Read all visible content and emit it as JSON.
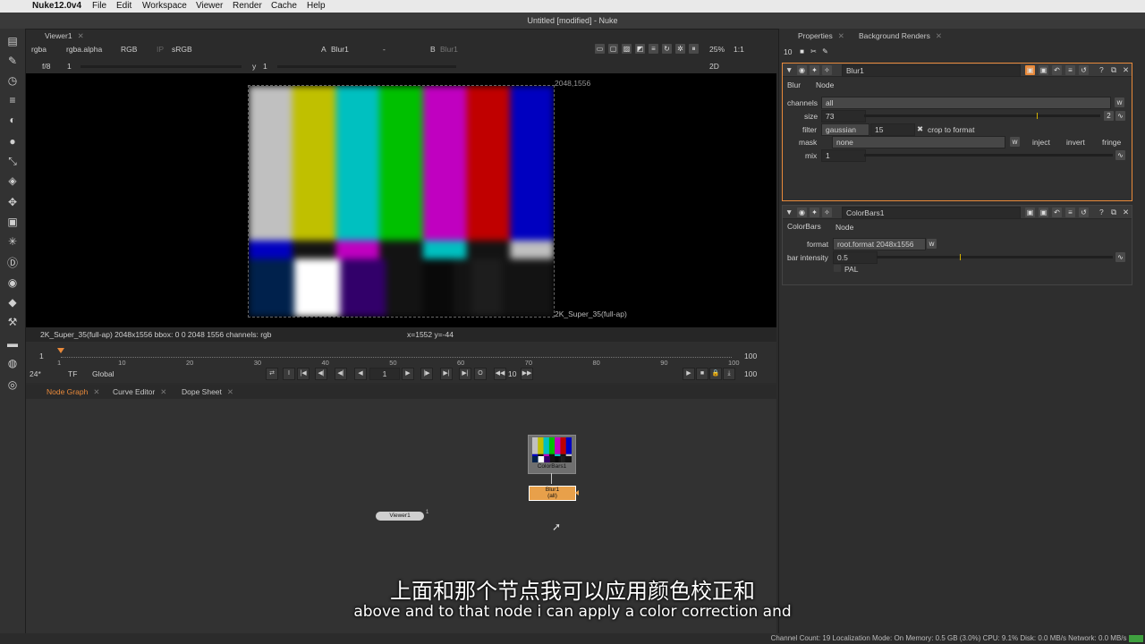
{
  "mac_menu": {
    "apple": "",
    "app": "Nuke12.0v4",
    "items": [
      "File",
      "Edit",
      "Workspace",
      "Viewer",
      "Render",
      "Cache",
      "Help"
    ]
  },
  "window_title": "Untitled [modified] - Nuke",
  "viewer": {
    "tab": "Viewer1",
    "channels": "rgba",
    "alpha": "rgba.alpha",
    "colorspace_sel": "RGB",
    "ip": "IP",
    "lut": "sRGB",
    "input_a_label": "A",
    "input_a": "Blur1",
    "dash": "-",
    "input_b_label": "B",
    "input_b": "Blur1",
    "zoom": "25%",
    "ratio": "1:1",
    "fstop": "f/8",
    "gain": "1",
    "gamma_label": "y",
    "gamma": "1",
    "view_mode": "2D",
    "corner_tr": "2048,1556",
    "format_label": "2K_Super_35(full-ap)",
    "info": "2K_Super_35(full-ap) 2048x1556  bbox: 0 0 2048 1556 channels: rgb",
    "coords": "x=1552 y=-44"
  },
  "timeline": {
    "start": "1",
    "end": "100",
    "ticks": [
      "1",
      "10",
      "20",
      "30",
      "40",
      "50",
      "60",
      "70",
      "80",
      "90",
      "100"
    ],
    "fps": "24*",
    "tf": "TF",
    "range": "Global",
    "frame": "1",
    "step": "10",
    "end_field": "100",
    "playhead_fraction": 0.0
  },
  "graph_tabs": [
    "Node Graph",
    "Curve Editor",
    "Dope Sheet"
  ],
  "nodes": {
    "colorbars": "ColorBars1",
    "blur": "Blur1",
    "blur_sub": "(all)",
    "viewer": "Viewer1",
    "viewer_input": "1"
  },
  "properties": {
    "tabs": [
      "Properties",
      "Background Renders"
    ],
    "max_panels": "10",
    "blur": {
      "name": "Blur1",
      "tabs": [
        "Blur",
        "Node"
      ],
      "channels_label": "channels",
      "channels": "all",
      "size_label": "size",
      "size": "73",
      "size_count": "2",
      "filter_label": "filter",
      "filter": "gaussian",
      "filter_quality": "15",
      "crop_label": "crop to format",
      "mask_label": "mask",
      "mask": "none",
      "inject": "inject",
      "invert": "invert",
      "fringe": "fringe",
      "mix_label": "mix",
      "mix": "1"
    },
    "colorbars": {
      "name": "ColorBars1",
      "tabs": [
        "ColorBars",
        "Node"
      ],
      "format_label": "format",
      "format": "root.format 2048x1556",
      "intensity_label": "bar intensity",
      "intensity": "0.5",
      "pal_label": "PAL"
    }
  },
  "status": "Channel Count: 19  Localization Mode: On  Memory: 0.5 GB (3.0%)  CPU: 9.1%  Disk: 0.0 MB/s  Network: 0.0 MB/s",
  "subtitle_cn": "上面和那个节点我可以应用颜色校正和",
  "subtitle_en": "above and to that node i can apply a color correction and",
  "colors": {
    "accent": "#e8893a",
    "node_blur": "#e8a04a",
    "bars_top": [
      "#c0c0c0",
      "#c0c000",
      "#00c0c0",
      "#00c000",
      "#c000c0",
      "#c00000",
      "#0000c0"
    ],
    "bars_mid": [
      "#0000c0",
      "#131313",
      "#c000c0",
      "#131313",
      "#00c0c0",
      "#131313",
      "#c0c0c0"
    ],
    "bars_bottom": [
      "#00214c",
      "#ffffff",
      "#32006a",
      "#131313",
      "#090909",
      "#131313",
      "#1d1d1d",
      "#131313"
    ]
  }
}
